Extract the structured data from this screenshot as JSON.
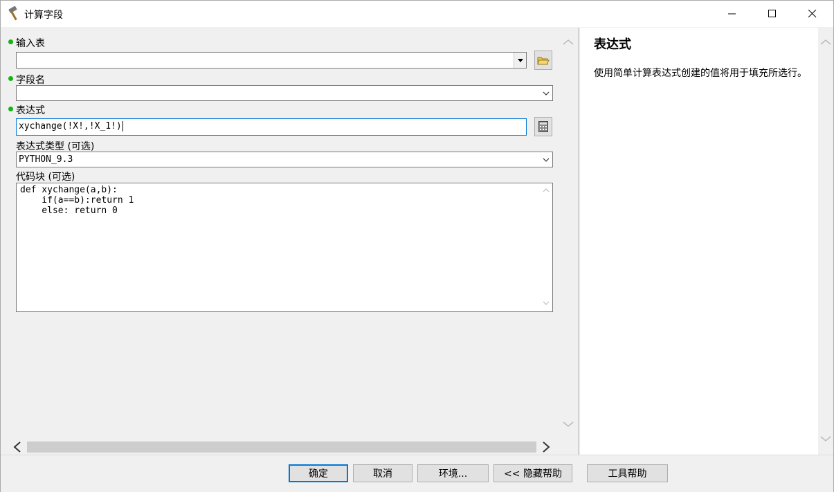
{
  "window": {
    "title": "计算字段",
    "icon": "hammer-icon"
  },
  "form": {
    "input_table": {
      "label": "输入表",
      "value": ""
    },
    "field_name": {
      "label": "字段名",
      "value": ""
    },
    "expression": {
      "label": "表达式",
      "value": "xychange(!X!,!X_1!)"
    },
    "expression_type": {
      "label": "表达式类型 (可选)",
      "value": "PYTHON_9.3"
    },
    "code_block": {
      "label": "代码块 (可选)",
      "lines": [
        "def xychange(a,b):",
        "    if(a==b):return 1",
        "    else: return 0"
      ]
    }
  },
  "help": {
    "title": "表达式",
    "body": "使用简单计算表达式创建的值将用于填充所选行。"
  },
  "buttons": {
    "ok": "确定",
    "cancel": "取消",
    "environments": "环境...",
    "hide_help": "<< 隐藏帮助",
    "tool_help": "工具帮助"
  },
  "colors": {
    "required_dot": "#14b414",
    "focus_border": "#0078d7"
  }
}
